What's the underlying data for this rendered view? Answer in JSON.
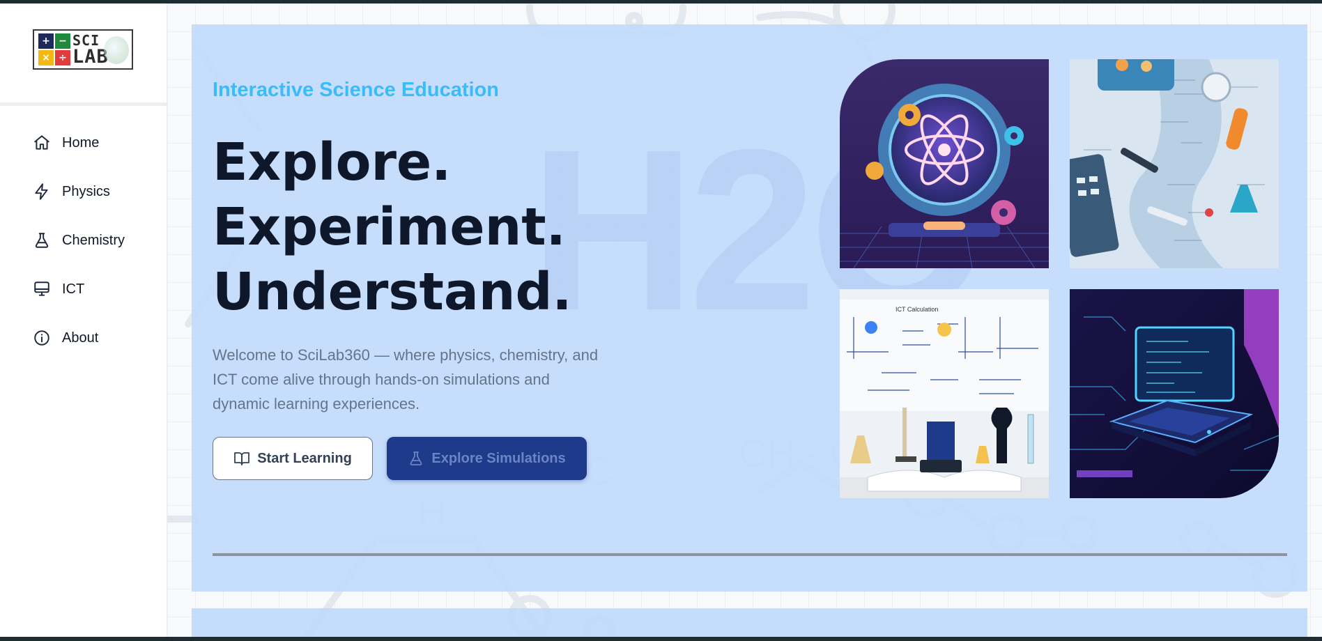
{
  "brand": {
    "logo_sci": "SCI",
    "logo_lab": "LAB",
    "logo_symbols": [
      "+",
      "−",
      "×",
      "÷"
    ]
  },
  "sidebar": {
    "items": [
      {
        "label": "Home",
        "icon": "home-icon"
      },
      {
        "label": "Physics",
        "icon": "lightning-icon"
      },
      {
        "label": "Chemistry",
        "icon": "flask-icon"
      },
      {
        "label": "ICT",
        "icon": "monitor-icon"
      },
      {
        "label": "About",
        "icon": "info-icon"
      }
    ]
  },
  "hero": {
    "eyebrow": "Interactive Science Education",
    "headline": [
      "Explore.",
      "Experiment.",
      "Understand."
    ],
    "watermark": "H2O",
    "description": "Welcome to SciLab360 — where physics, chemistry, and ICT come alive through hands-on simulations and dynamic learning experiences.",
    "buttons": {
      "start_label": "Start Learning",
      "explore_label": "Explore Simulations"
    },
    "images": [
      {
        "name": "atom-illustration",
        "alt": "Atom illustration with gears"
      },
      {
        "name": "physics-desk-flatlay",
        "alt": "Calculators, equations and lab tools"
      },
      {
        "name": "lab-whiteboard-photo",
        "alt": "Lab bench with microscope and whiteboard",
        "board_title": "ICT Calculation"
      },
      {
        "name": "neon-laptop-illustration",
        "alt": "Neon laptop with code"
      }
    ]
  },
  "colors": {
    "hero_bg": "#bfd9fc",
    "eyebrow": "#38bdf8",
    "headline": "#0f172a",
    "primary_button": "#1e3a8a",
    "text_muted": "#64748b"
  }
}
